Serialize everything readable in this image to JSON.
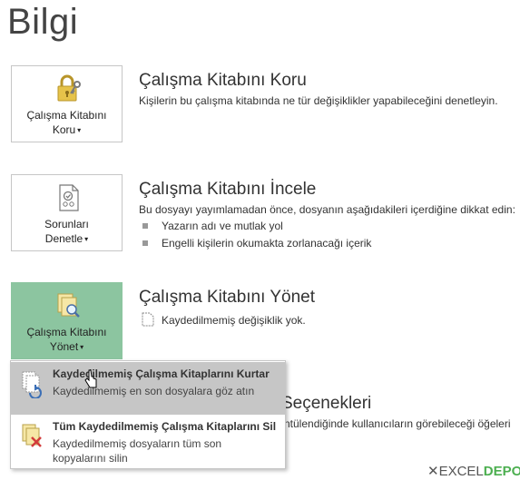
{
  "page": {
    "title": "Bilgi"
  },
  "protect": {
    "tile_line1": "Çalışma Kitabını",
    "tile_line2": "Koru",
    "title": "Çalışma Kitabını Koru",
    "desc": "Kişilerin bu çalışma kitabında ne tür değişiklikler yapabileceğini denetleyin."
  },
  "inspect": {
    "tile_line1": "Sorunları",
    "tile_line2": "Denetle",
    "title": "Çalışma Kitabını İncele",
    "desc": "Bu dosyayı yayımlamadan önce, dosyanın aşağıdakileri içerdiğine dikkat edin:",
    "bullets": [
      "Yazarın adı ve mutlak yol",
      "Engelli kişilerin okumakta zorlanacağı içerik"
    ]
  },
  "manage": {
    "tile_line1": "Çalışma Kitabını",
    "tile_line2": "Yönet",
    "title": "Çalışma Kitabını Yönet",
    "note": "Kaydedilmemiş değişiklik yok."
  },
  "options_partial": {
    "title": "Seçenekleri",
    "desc": "ntülendiğinde kullanıcıların görebileceği öğeleri"
  },
  "dropdown": {
    "items": [
      {
        "title": "Kaydedilmemiş Çalışma Kitaplarını Kurtar",
        "desc": "Kaydedilmemiş en son dosyalara göz atın"
      },
      {
        "title": "Tüm Kaydedilmemiş Çalışma Kitaplarını Sil",
        "desc": "Kaydedilmemiş dosyaların tüm son kopyalarını silin"
      }
    ]
  },
  "watermark": {
    "part1": "EXCEL",
    "part2": "DEPO"
  },
  "colors": {
    "active_tile": "#8cc5a0",
    "hover_item": "#c6c6c6",
    "watermark_green": "#4caf50",
    "watermark_gray": "#555555"
  }
}
